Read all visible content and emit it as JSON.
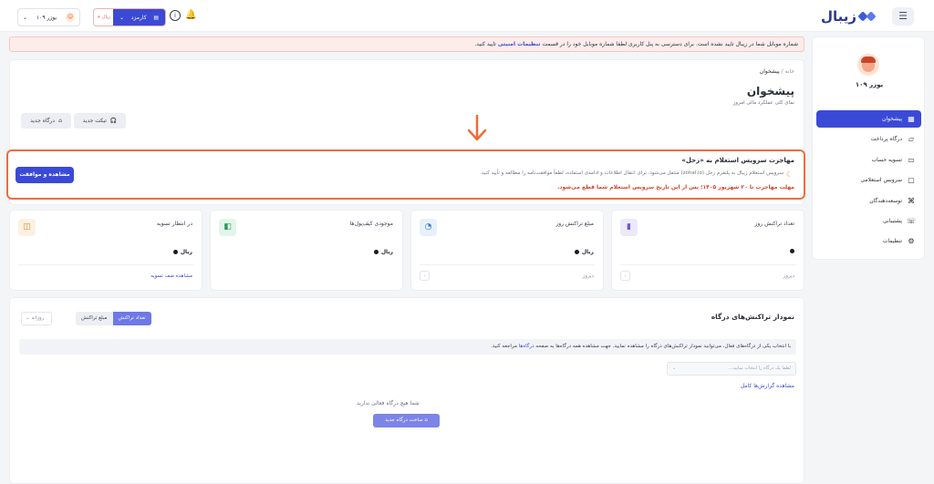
{
  "topbar": {
    "logo_text": "زیبال",
    "gateway_select": {
      "label": "کارمزد",
      "left_value": "+ ریال"
    },
    "user_select": {
      "label": "یوزر ۱۰۹"
    }
  },
  "alert": {
    "text": "شماره موبایل شما در زیبال تایید نشده است. برای دسترسی به پنل کاربری لطفا شماره موبایل خود را در قسمت",
    "link": "تنظیمات امنیتی",
    "suffix": "تایید کنید."
  },
  "sidebar": {
    "profile_name": "یوزر ۱۰۹",
    "items": [
      {
        "label": "پیشخوان",
        "icon": "dashboard-icon"
      },
      {
        "label": "درگاه پرداخت",
        "icon": "card-icon"
      },
      {
        "label": "تسویه حساب",
        "icon": "wallet-icon"
      },
      {
        "label": "سرویس استعلامی",
        "icon": "inquiry-icon"
      },
      {
        "label": "توسعه‌دهندگان",
        "icon": "code-icon"
      },
      {
        "label": "پشتیبانی",
        "icon": "support-icon"
      },
      {
        "label": "تنظیمات",
        "icon": "gear-icon"
      }
    ]
  },
  "page": {
    "breadcrumb_home": "خانه",
    "breadcrumb_sep": "/",
    "breadcrumb_current": "پیشخوان",
    "title": "پیشخوان",
    "subtitle": "نمای کلی عملکرد مالی امروز",
    "new_ticket": "تیکت جدید",
    "new_gateway": "درگاه جدید"
  },
  "migration": {
    "title": "مهاجرت سرویس استعلام به «زحل»",
    "description": "سرویس استعلام زیبال به پلتفرم زحل (zohal.io) منتقل می‌شود. برای انتقال اطلاعات و ادامه‌ی استفاده، لطفاً موافقت‌نامه را مطالعه و تأیید کنید.",
    "warning": "مهلت مهاجرت تا ۲۰ شهریور ۱۴۰۵؛ پس از این تاریخ سرویس استعلام شما قطع می‌شود.",
    "button": "مشاهده و موافقت"
  },
  "stats": [
    {
      "title": "تعداد تراکنش روز",
      "value": "",
      "unit": "",
      "footer": "دیروز",
      "mini": "-",
      "color": "#ece9fb",
      "icon_color": "#6d5bd0",
      "icon": "chart-icon"
    },
    {
      "title": "مبلغ تراکنش روز",
      "value": "",
      "unit": "ریال",
      "footer": "دیروز",
      "mini": "-",
      "color": "#e7f0fb",
      "icon_color": "#2f74c8",
      "icon": "gauge-icon"
    },
    {
      "title": "موجودی کیف‌پول‌ها",
      "value": "",
      "unit": "ریال",
      "footer": "",
      "mini": "",
      "color": "#e3f5ea",
      "icon_color": "#2c9a58",
      "icon": "wallet-icon"
    },
    {
      "title": "در انتظار تسویه",
      "value": "",
      "unit": "ریال",
      "footer": "مشاهده صف تسویه",
      "mini": "",
      "color": "#fdf0e3",
      "icon_color": "#e08a2e",
      "icon": "clock-icon"
    }
  ],
  "chart_section": {
    "title": "نمودار تراکنش‌های درگاه",
    "tab_count": "تعداد تراکنش",
    "tab_amount": "مبلغ تراکنش",
    "period": "روزانه",
    "info_text": "با انتخاب یکی از درگاه‌های فعال، می‌توانید نمودار تراکنش‌های درگاه را مشاهده نمایید. جهت مشاهده همه درگاه‌ها به صفحه",
    "info_link": "درگاه‌ها",
    "info_suffix": "مراجعه کنید.",
    "filter_placeholder": "لطفا یک درگاه را انتخاب نمایید...",
    "full_report": "مشاهده گزارش‌ها کامل",
    "empty_text": "شما هیچ درگاه فعالی ندارید",
    "empty_button": "ساخت درگاه جدید"
  }
}
